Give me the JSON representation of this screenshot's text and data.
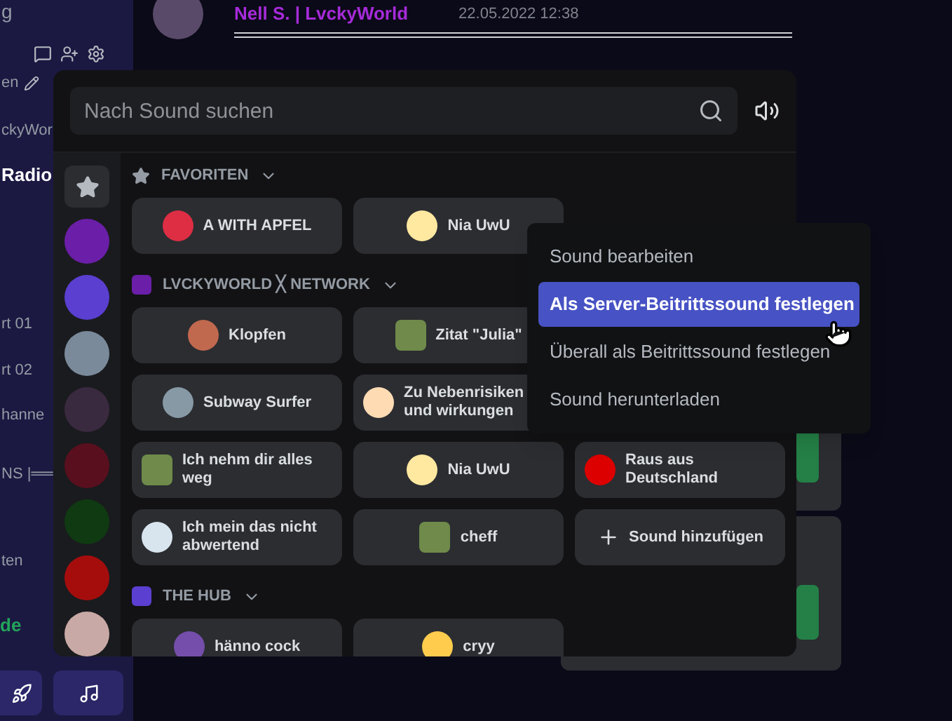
{
  "sidebar": {
    "top_text": "g",
    "items": [
      {
        "text": "en",
        "selected": false
      },
      {
        "text": "ckyWor",
        "selected": false
      },
      {
        "text": "Radio",
        "selected": true
      },
      {
        "text": "rt 01",
        "selected": false
      },
      {
        "text": "rt 02",
        "selected": false
      },
      {
        "text": "hanne",
        "selected": false
      },
      {
        "text": "NS |══",
        "selected": false
      },
      {
        "text": "ten",
        "selected": false
      }
    ],
    "status": "de"
  },
  "message": {
    "author": "Nell S. | LvckyWorld",
    "time": "22.05.2022 12:38"
  },
  "sound_picker": {
    "search": {
      "placeholder": "Nach Sound suchen"
    },
    "rail": [
      {
        "kind": "favorites",
        "selected": true
      },
      {
        "kind": "server",
        "color": "#6b1fa8",
        "selected": false
      },
      {
        "kind": "server",
        "color": "#5b3fd0",
        "selected": false
      },
      {
        "kind": "server",
        "color": "#7a8a9a",
        "selected": false
      },
      {
        "kind": "server",
        "color": "#3a2a40",
        "selected": false
      },
      {
        "kind": "server",
        "color": "#5a0f1e",
        "selected": false
      },
      {
        "kind": "server",
        "color": "#0f3a12",
        "selected": false
      },
      {
        "kind": "server",
        "color": "#a50d0d",
        "selected": false
      },
      {
        "kind": "server",
        "color": "#c9a9a6",
        "selected": false
      }
    ],
    "sections": [
      {
        "kind": "favorites",
        "title": "FAVORITEN",
        "rows": [
          [
            {
              "label": "A WITH APFEL",
              "kind": "emoji",
              "color": "#dd2e44"
            },
            {
              "label": "Nia UwU",
              "kind": "emoji",
              "color": "#ffe8a0"
            }
          ]
        ]
      },
      {
        "kind": "server",
        "title": "LVCKYWORLD ╳ NETWORK",
        "color": "#6b1fa8",
        "rows": [
          [
            {
              "label": "Klopfen",
              "kind": "emoji",
              "color": "#c1694f"
            },
            {
              "label": "Zitat \"Julia\"",
              "kind": "image"
            }
          ],
          [
            {
              "label": "Subway Surfer",
              "kind": "emoji",
              "color": "#8899a6"
            },
            {
              "label": "Zu Nebenrisiken und wirkungen",
              "kind": "emoji",
              "color": "#ffdbb4"
            }
          ],
          [
            {
              "label": "Ich nehm dir alles weg",
              "kind": "image"
            },
            {
              "label": "Nia UwU",
              "kind": "emoji",
              "color": "#ffe8a0"
            },
            {
              "label": "Raus aus Deutschland",
              "kind": "emoji",
              "color": "#dd0000"
            }
          ],
          [
            {
              "label": "Ich mein das nicht abwertend",
              "kind": "emoji",
              "color": "#d8e4ee"
            },
            {
              "label": "cheff",
              "kind": "image"
            },
            {
              "label": "Sound hinzufügen",
              "kind": "add"
            }
          ]
        ]
      },
      {
        "kind": "server",
        "title": "THE HUB",
        "color": "#5b3fd0",
        "rows": [
          [
            {
              "label": "hänno cock",
              "kind": "emoji",
              "color": "#744eaa"
            },
            {
              "label": "cryy",
              "kind": "emoji",
              "color": "#ffcc4d"
            }
          ]
        ]
      }
    ]
  },
  "context_menu": {
    "items": [
      {
        "label": "Sound bearbeiten",
        "selected": false
      },
      {
        "label": "Als Server-Beitrittssound festlegen",
        "selected": true
      },
      {
        "label": "Überall als Beitrittssound festlegen",
        "selected": false
      },
      {
        "label": "Sound herunterladen",
        "selected": false
      }
    ]
  }
}
